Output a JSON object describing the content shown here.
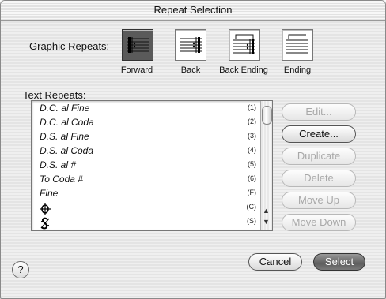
{
  "window": {
    "title": "Repeat Selection"
  },
  "graphic_repeats": {
    "label": "Graphic Repeats:",
    "options": [
      {
        "label": "Forward",
        "selected": true
      },
      {
        "label": "Back",
        "selected": false
      },
      {
        "label": "Back Ending",
        "selected": false
      },
      {
        "label": "Ending",
        "selected": false
      }
    ]
  },
  "text_repeats": {
    "label": "Text Repeats:",
    "items": [
      {
        "text": "D.C. al Fine",
        "code": "(1)"
      },
      {
        "text": "D.C. al Coda",
        "code": "(2)"
      },
      {
        "text": "D.S. al Fine",
        "code": "(3)"
      },
      {
        "text": "D.S. al Coda",
        "code": "(4)"
      },
      {
        "text": "D.S. al #",
        "code": "(5)"
      },
      {
        "text": "To Coda #",
        "code": "(6)"
      },
      {
        "text": "Fine",
        "code": "(F)"
      },
      {
        "text": "coda-symbol",
        "code": "(C)"
      },
      {
        "text": "segno-symbol",
        "code": "(S)"
      }
    ]
  },
  "side_buttons": [
    {
      "label": "Edit...",
      "enabled": false
    },
    {
      "label": "Create...",
      "enabled": true
    },
    {
      "label": "Duplicate",
      "enabled": false
    },
    {
      "label": "Delete",
      "enabled": false
    },
    {
      "label": "Move Up",
      "enabled": false
    },
    {
      "label": "Move Down",
      "enabled": false
    }
  ],
  "footer": {
    "help": "?",
    "cancel": "Cancel",
    "select": "Select"
  }
}
